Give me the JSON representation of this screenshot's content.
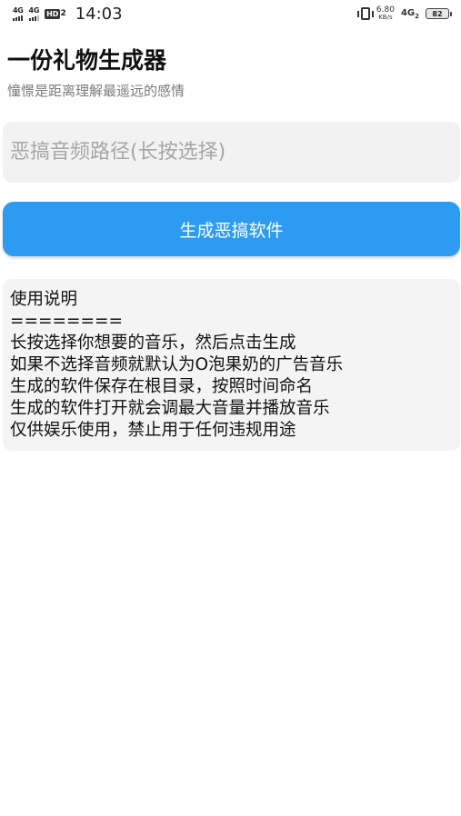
{
  "status_bar": {
    "network_1": "4G",
    "network_2": "4G",
    "hd_label": "HD",
    "hd_sub": "2",
    "time": "14:03",
    "speed_value": "6.80",
    "speed_unit": "KB/s",
    "network_3": "4G",
    "network_3_sub": "2",
    "battery_level": "82"
  },
  "app": {
    "title": "一份礼物生成器",
    "subtitle": "憧憬是距离理解最遥远的感情"
  },
  "form": {
    "path_value": "",
    "path_placeholder": "恶搞音频路径(长按选择)",
    "generate_label": "生成恶搞软件"
  },
  "instructions": {
    "lines": [
      "使用说明",
      "========",
      "长按选择你想要的音乐，然后点击生成",
      "如果不选择音频就默认为O泡果奶的广告音乐",
      "生成的软件保存在根目录，按照时间命名",
      "生成的软件打开就会调最大音量并播放音乐",
      "仅供娱乐使用，禁止用于任何违规用途"
    ]
  },
  "colors": {
    "accent": "#2d9cf0",
    "input_bg": "#f2f2f2",
    "card_bg": "#f4f4f4",
    "subtitle": "#7a7a7a"
  }
}
